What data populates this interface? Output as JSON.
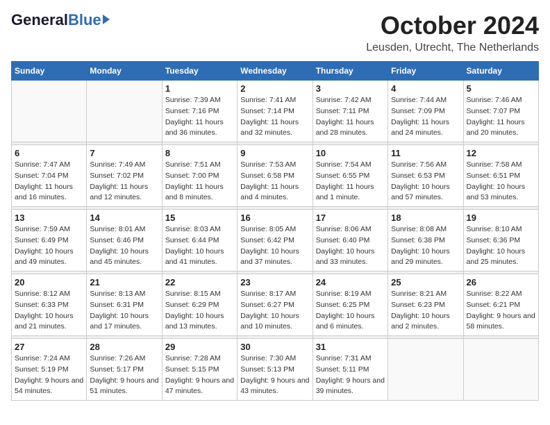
{
  "logo": {
    "general": "General",
    "blue": "Blue"
  },
  "title": "October 2024",
  "location": "Leusden, Utrecht, The Netherlands",
  "weekdays": [
    "Sunday",
    "Monday",
    "Tuesday",
    "Wednesday",
    "Thursday",
    "Friday",
    "Saturday"
  ],
  "weeks": [
    [
      {
        "day": "",
        "sunrise": "",
        "sunset": "",
        "daylight": ""
      },
      {
        "day": "",
        "sunrise": "",
        "sunset": "",
        "daylight": ""
      },
      {
        "day": "1",
        "sunrise": "Sunrise: 7:39 AM",
        "sunset": "Sunset: 7:16 PM",
        "daylight": "Daylight: 11 hours and 36 minutes."
      },
      {
        "day": "2",
        "sunrise": "Sunrise: 7:41 AM",
        "sunset": "Sunset: 7:14 PM",
        "daylight": "Daylight: 11 hours and 32 minutes."
      },
      {
        "day": "3",
        "sunrise": "Sunrise: 7:42 AM",
        "sunset": "Sunset: 7:11 PM",
        "daylight": "Daylight: 11 hours and 28 minutes."
      },
      {
        "day": "4",
        "sunrise": "Sunrise: 7:44 AM",
        "sunset": "Sunset: 7:09 PM",
        "daylight": "Daylight: 11 hours and 24 minutes."
      },
      {
        "day": "5",
        "sunrise": "Sunrise: 7:46 AM",
        "sunset": "Sunset: 7:07 PM",
        "daylight": "Daylight: 11 hours and 20 minutes."
      }
    ],
    [
      {
        "day": "6",
        "sunrise": "Sunrise: 7:47 AM",
        "sunset": "Sunset: 7:04 PM",
        "daylight": "Daylight: 11 hours and 16 minutes."
      },
      {
        "day": "7",
        "sunrise": "Sunrise: 7:49 AM",
        "sunset": "Sunset: 7:02 PM",
        "daylight": "Daylight: 11 hours and 12 minutes."
      },
      {
        "day": "8",
        "sunrise": "Sunrise: 7:51 AM",
        "sunset": "Sunset: 7:00 PM",
        "daylight": "Daylight: 11 hours and 8 minutes."
      },
      {
        "day": "9",
        "sunrise": "Sunrise: 7:53 AM",
        "sunset": "Sunset: 6:58 PM",
        "daylight": "Daylight: 11 hours and 4 minutes."
      },
      {
        "day": "10",
        "sunrise": "Sunrise: 7:54 AM",
        "sunset": "Sunset: 6:55 PM",
        "daylight": "Daylight: 11 hours and 1 minute."
      },
      {
        "day": "11",
        "sunrise": "Sunrise: 7:56 AM",
        "sunset": "Sunset: 6:53 PM",
        "daylight": "Daylight: 10 hours and 57 minutes."
      },
      {
        "day": "12",
        "sunrise": "Sunrise: 7:58 AM",
        "sunset": "Sunset: 6:51 PM",
        "daylight": "Daylight: 10 hours and 53 minutes."
      }
    ],
    [
      {
        "day": "13",
        "sunrise": "Sunrise: 7:59 AM",
        "sunset": "Sunset: 6:49 PM",
        "daylight": "Daylight: 10 hours and 49 minutes."
      },
      {
        "day": "14",
        "sunrise": "Sunrise: 8:01 AM",
        "sunset": "Sunset: 6:46 PM",
        "daylight": "Daylight: 10 hours and 45 minutes."
      },
      {
        "day": "15",
        "sunrise": "Sunrise: 8:03 AM",
        "sunset": "Sunset: 6:44 PM",
        "daylight": "Daylight: 10 hours and 41 minutes."
      },
      {
        "day": "16",
        "sunrise": "Sunrise: 8:05 AM",
        "sunset": "Sunset: 6:42 PM",
        "daylight": "Daylight: 10 hours and 37 minutes."
      },
      {
        "day": "17",
        "sunrise": "Sunrise: 8:06 AM",
        "sunset": "Sunset: 6:40 PM",
        "daylight": "Daylight: 10 hours and 33 minutes."
      },
      {
        "day": "18",
        "sunrise": "Sunrise: 8:08 AM",
        "sunset": "Sunset: 6:38 PM",
        "daylight": "Daylight: 10 hours and 29 minutes."
      },
      {
        "day": "19",
        "sunrise": "Sunrise: 8:10 AM",
        "sunset": "Sunset: 6:36 PM",
        "daylight": "Daylight: 10 hours and 25 minutes."
      }
    ],
    [
      {
        "day": "20",
        "sunrise": "Sunrise: 8:12 AM",
        "sunset": "Sunset: 6:33 PM",
        "daylight": "Daylight: 10 hours and 21 minutes."
      },
      {
        "day": "21",
        "sunrise": "Sunrise: 8:13 AM",
        "sunset": "Sunset: 6:31 PM",
        "daylight": "Daylight: 10 hours and 17 minutes."
      },
      {
        "day": "22",
        "sunrise": "Sunrise: 8:15 AM",
        "sunset": "Sunset: 6:29 PM",
        "daylight": "Daylight: 10 hours and 13 minutes."
      },
      {
        "day": "23",
        "sunrise": "Sunrise: 8:17 AM",
        "sunset": "Sunset: 6:27 PM",
        "daylight": "Daylight: 10 hours and 10 minutes."
      },
      {
        "day": "24",
        "sunrise": "Sunrise: 8:19 AM",
        "sunset": "Sunset: 6:25 PM",
        "daylight": "Daylight: 10 hours and 6 minutes."
      },
      {
        "day": "25",
        "sunrise": "Sunrise: 8:21 AM",
        "sunset": "Sunset: 6:23 PM",
        "daylight": "Daylight: 10 hours and 2 minutes."
      },
      {
        "day": "26",
        "sunrise": "Sunrise: 8:22 AM",
        "sunset": "Sunset: 6:21 PM",
        "daylight": "Daylight: 9 hours and 58 minutes."
      }
    ],
    [
      {
        "day": "27",
        "sunrise": "Sunrise: 7:24 AM",
        "sunset": "Sunset: 5:19 PM",
        "daylight": "Daylight: 9 hours and 54 minutes."
      },
      {
        "day": "28",
        "sunrise": "Sunrise: 7:26 AM",
        "sunset": "Sunset: 5:17 PM",
        "daylight": "Daylight: 9 hours and 51 minutes."
      },
      {
        "day": "29",
        "sunrise": "Sunrise: 7:28 AM",
        "sunset": "Sunset: 5:15 PM",
        "daylight": "Daylight: 9 hours and 47 minutes."
      },
      {
        "day": "30",
        "sunrise": "Sunrise: 7:30 AM",
        "sunset": "Sunset: 5:13 PM",
        "daylight": "Daylight: 9 hours and 43 minutes."
      },
      {
        "day": "31",
        "sunrise": "Sunrise: 7:31 AM",
        "sunset": "Sunset: 5:11 PM",
        "daylight": "Daylight: 9 hours and 39 minutes."
      },
      {
        "day": "",
        "sunrise": "",
        "sunset": "",
        "daylight": ""
      },
      {
        "day": "",
        "sunrise": "",
        "sunset": "",
        "daylight": ""
      }
    ]
  ]
}
